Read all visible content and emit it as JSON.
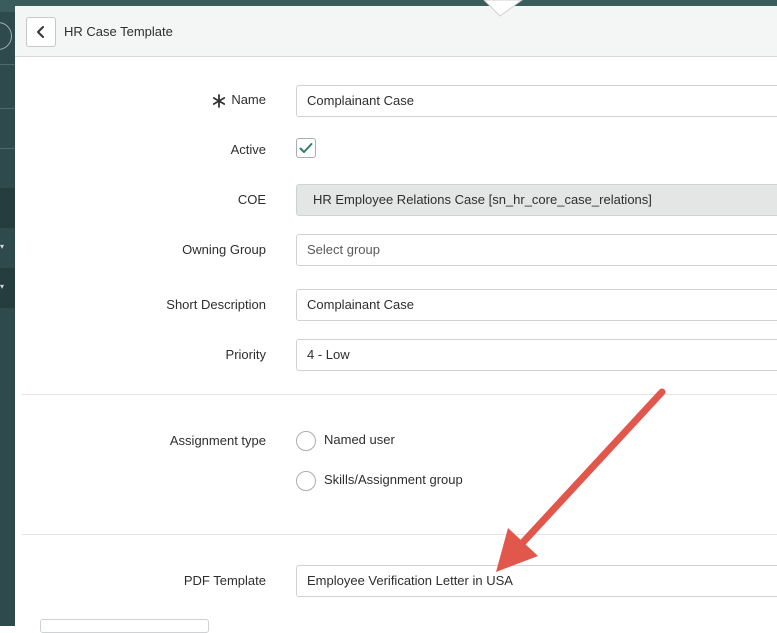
{
  "header": {
    "back_icon": "chevron-left-icon",
    "title": "HR Case Template"
  },
  "form": {
    "name": {
      "label": "Name",
      "value": "Complainant Case",
      "required": true
    },
    "active": {
      "label": "Active",
      "checked": true
    },
    "coe": {
      "label": "COE",
      "value": "HR Employee Relations Case [sn_hr_core_case_relations]"
    },
    "owning_group": {
      "label": "Owning Group",
      "placeholder": "Select group"
    },
    "short_description": {
      "label": "Short Description",
      "value": "Complainant Case"
    },
    "priority": {
      "label": "Priority",
      "value": "4 - Low"
    },
    "assignment_type": {
      "label": "Assignment type",
      "options": [
        {
          "label": "Named user",
          "selected": false
        },
        {
          "label": "Skills/Assignment group",
          "selected": false
        }
      ]
    },
    "pdf_template": {
      "label": "PDF Template",
      "value": "Employee Verification Letter in USA"
    }
  },
  "colors": {
    "sidebar": "#2f4a4c",
    "header_bg": "#f4f5f5",
    "readonly_bg": "#e4e6e6",
    "checkmark": "#2e7d6e",
    "annotation_arrow": "#e2574c"
  }
}
